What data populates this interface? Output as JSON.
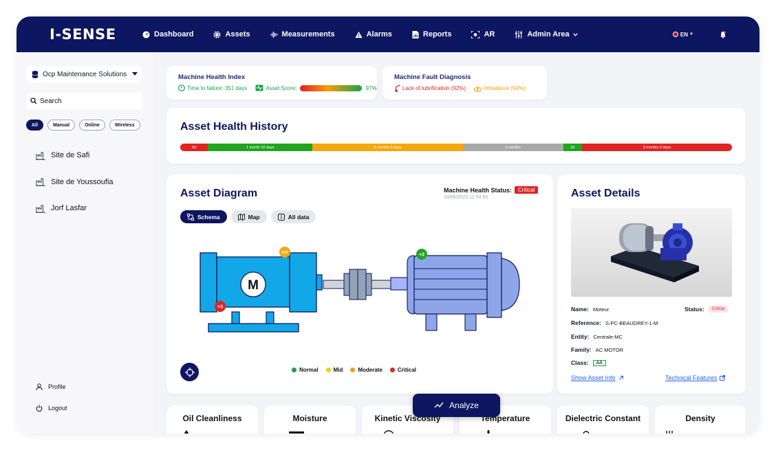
{
  "app": {
    "logo": "I-SENSE"
  },
  "nav": {
    "items": [
      {
        "label": "Dashboard",
        "icon": "gauge-icon"
      },
      {
        "label": "Assets",
        "icon": "gear-icon"
      },
      {
        "label": "Measurements",
        "icon": "waveform-icon"
      },
      {
        "label": "Alarms",
        "icon": "warning-icon"
      },
      {
        "label": "Reports",
        "icon": "report-icon"
      },
      {
        "label": "AR",
        "icon": "ar-icon"
      },
      {
        "label": "Admin Area",
        "icon": "sliders-icon"
      }
    ],
    "language": "EN"
  },
  "sidebar": {
    "organization": "Ocp Maintenance Solutions",
    "search_label": "Search",
    "filters": [
      "All",
      "Manual",
      "Online",
      "Wireless"
    ],
    "sites": [
      "Site de Safi",
      "Site de Youssoufia",
      "Jorf Lasfar"
    ],
    "profile": "Profile",
    "logout": "Logout"
  },
  "health_index": {
    "title": "Machine Health Index",
    "time_to_failure": "Time to failure: 351 days",
    "asset_score_label": "Asset Score:",
    "asset_score": "97%"
  },
  "fault_diagnosis": {
    "title": "Machine Fault Diagnosis",
    "fault1": "Lack of lubrification (92%)",
    "fault2": "Imbalance (54%)"
  },
  "history": {
    "title": "Asset Health History",
    "segments": [
      {
        "label": "5d",
        "color": "#e02424",
        "fraction": 0.05
      },
      {
        "label": "1 month 10 days",
        "color": "#1fa51f",
        "fraction": 0.19
      },
      {
        "label": "3 months 3 days",
        "color": "#f5a70f",
        "fraction": 0.272
      },
      {
        "label": "2 months",
        "color": "#a8a8a8",
        "fraction": 0.182
      },
      {
        "label": "2d",
        "color": "#1fa51f",
        "fraction": 0.034
      },
      {
        "label": "3 months 3 days",
        "color": "#e02424",
        "fraction": 0.272
      }
    ]
  },
  "diagram": {
    "title": "Asset Diagram",
    "status_label": "Machine Health Status:",
    "status_value": "Critical",
    "status_time": "10/06/2023 12:34:55",
    "tabs": [
      "Schema",
      "Map",
      "All data"
    ],
    "motor_letter": "M",
    "badges": {
      "motor_top": "1AX",
      "motor_bottom": "+3",
      "pump_top": "+2"
    },
    "legend": [
      {
        "label": "Normal",
        "color": "#16a34a"
      },
      {
        "label": "Mid",
        "color": "#e8d21a"
      },
      {
        "label": "Moderate",
        "color": "#f59e0b"
      },
      {
        "label": "Critical",
        "color": "#dc2626"
      }
    ]
  },
  "details": {
    "title": "Asset Details",
    "name_label": "Name:",
    "name": "Moteur",
    "status_label": "Status:",
    "status": "Critical",
    "reference_label": "Reference:",
    "reference": "S-PC-BEAUDREY-1-M",
    "entity_label": "Entity:",
    "entity": "Centrale-MC",
    "family_label": "Family:",
    "family": "AC MOTOR",
    "class_label": "Class:",
    "class": "AA",
    "show_info": "Show Asset Info",
    "tech_features": "Technical Features"
  },
  "metrics": [
    "Oil Cleanliness",
    "Moisture",
    "Kinetic Viscosity",
    "Temperature",
    "Dielectric Constant",
    "Density"
  ],
  "analyze_label": "Analyze"
}
